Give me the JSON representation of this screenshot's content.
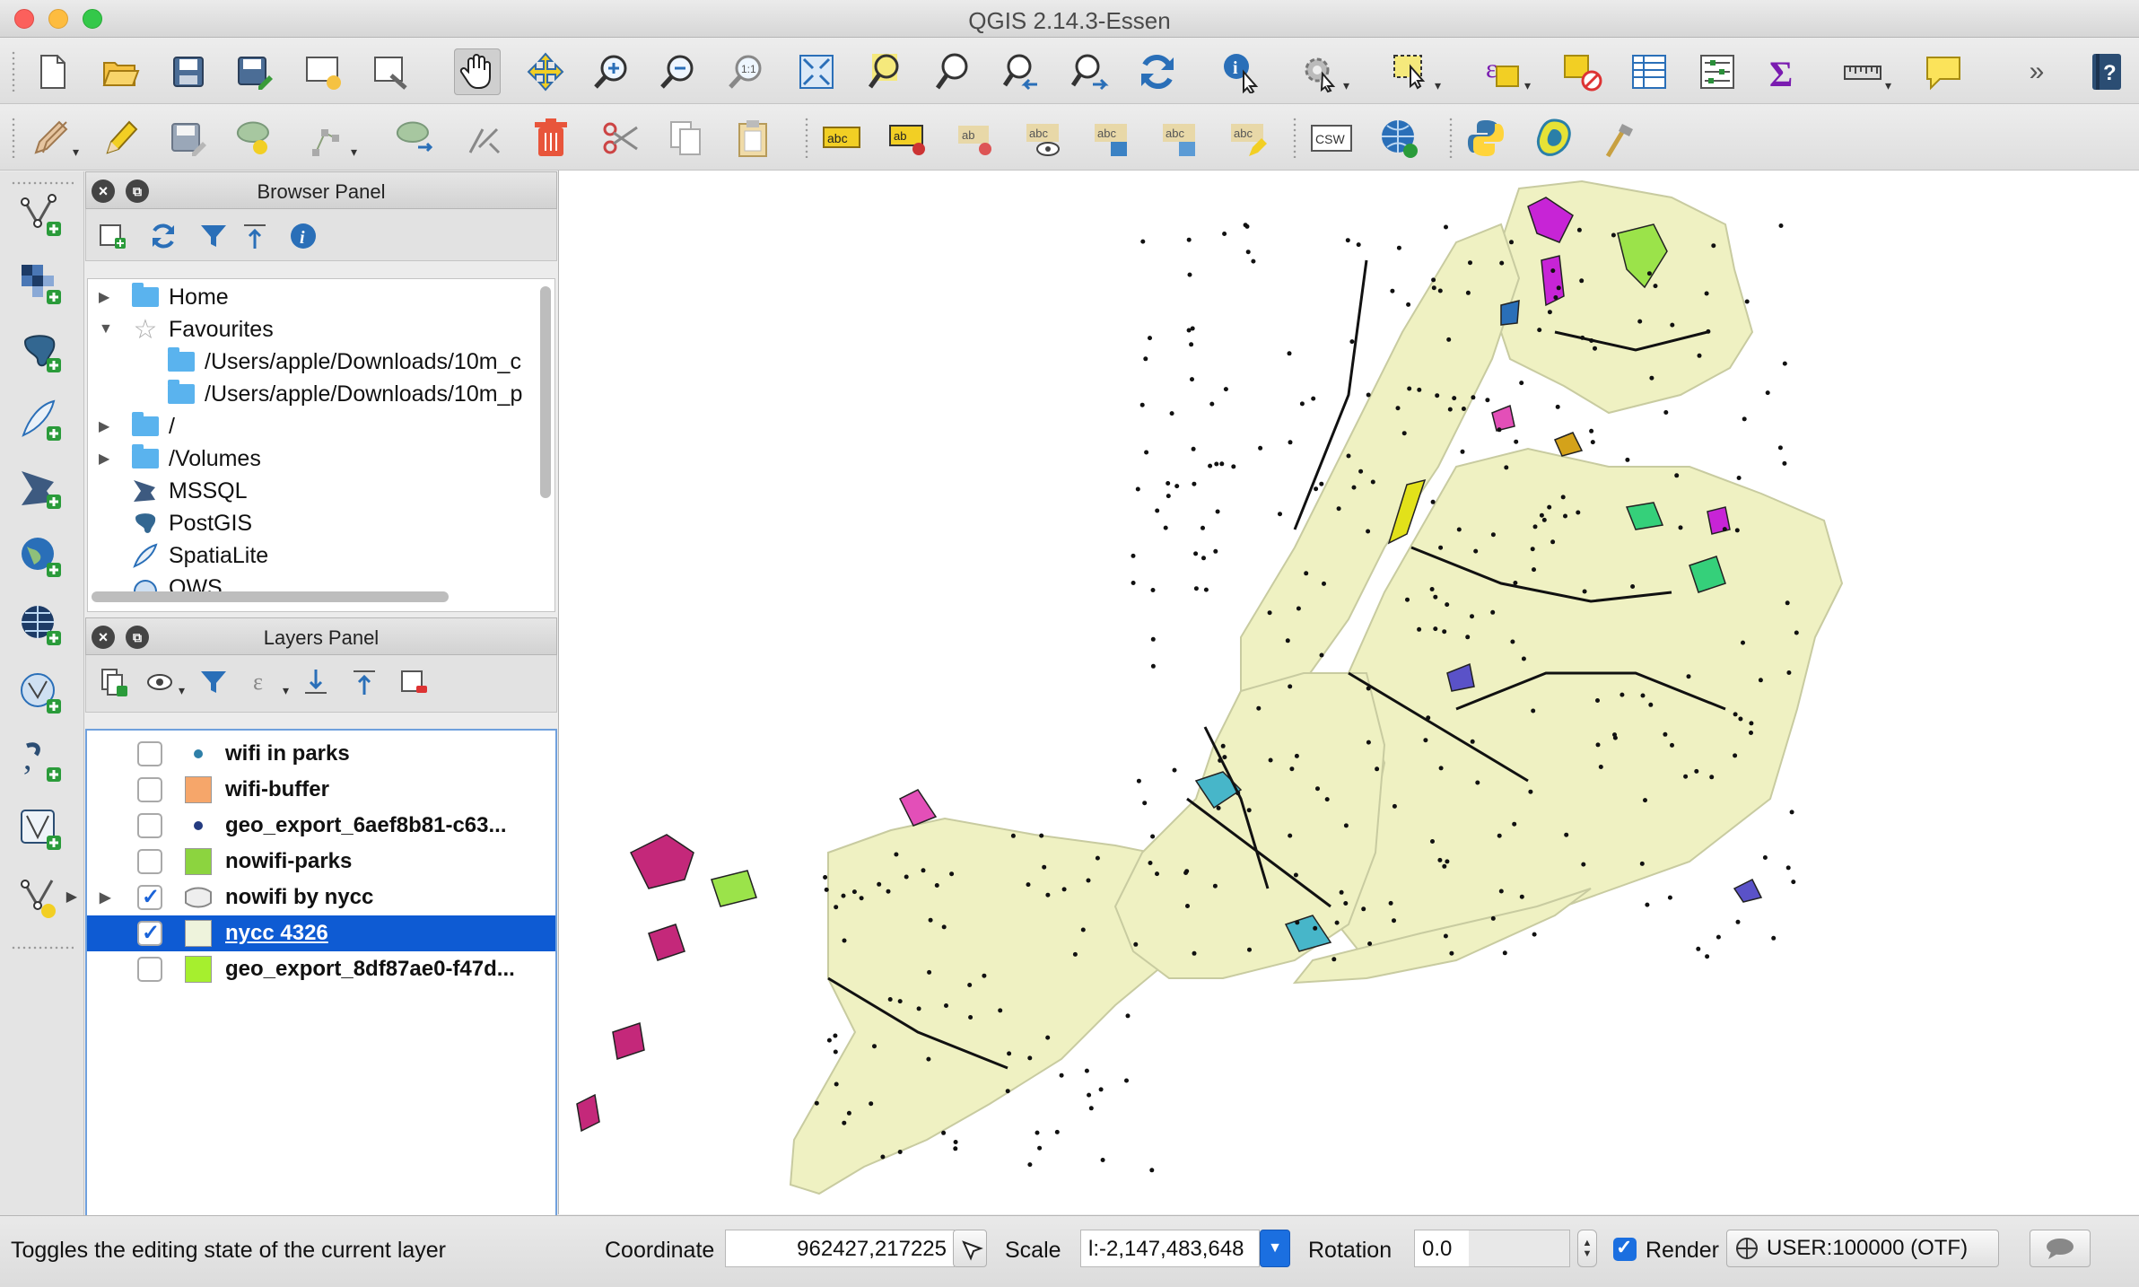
{
  "window": {
    "title": "QGIS 2.14.3-Essen"
  },
  "toolbar1": {
    "icons": [
      "new-project-icon",
      "open-project-icon",
      "save-project-icon",
      "save-as-icon",
      "new-print-composer-icon",
      "composer-manager-icon",
      "pan-icon",
      "pan-to-selection-icon",
      "zoom-in-icon",
      "zoom-out-icon",
      "zoom-native-icon",
      "zoom-full-icon",
      "zoom-to-selection-icon",
      "zoom-to-layer-icon",
      "zoom-last-icon",
      "zoom-next-icon",
      "refresh-icon",
      "identify-icon",
      "action-icon",
      "select-icon",
      "expression-select-icon",
      "deselect-icon",
      "attribute-table-icon",
      "statistics-icon",
      "sum-icon",
      "measure-icon",
      "annotation-icon",
      "overflow-icon",
      "help-icon"
    ]
  },
  "toolbar2": {
    "icons": [
      "current-edits-icon",
      "toggle-editing-icon",
      "save-edits-icon",
      "add-feature-icon",
      "node-tool-icon",
      "move-feature-icon",
      "delete-part-icon",
      "delete-selected-icon",
      "cut-features-icon",
      "copy-features-icon",
      "paste-features-icon",
      "label-tool-icon",
      "pin-labels-icon",
      "highlight-labels-icon",
      "show-hide-labels-icon",
      "move-label-icon",
      "rotate-label-icon",
      "change-label-icon",
      "csw-icon",
      "openlayers-icon",
      "python-console-icon",
      "georeferencer-icon",
      "gps-tools-icon"
    ],
    "csw_label": "CSW"
  },
  "left_toolbar": {
    "icons": [
      "add-vector-layer-icon",
      "add-raster-layer-icon",
      "add-postgis-layer-icon",
      "add-spatialite-layer-icon",
      "add-mssql-layer-icon",
      "add-wms-layer-icon",
      "add-wcs-layer-icon",
      "add-wfs-layer-icon",
      "add-delimited-text-layer-icon",
      "add-virtual-layer-icon",
      "new-shapefile-layer-icon"
    ]
  },
  "browser_panel": {
    "title": "Browser Panel",
    "tools": [
      "add-selected-icon",
      "refresh-icon",
      "filter-icon",
      "collapse-all-icon",
      "properties-icon"
    ],
    "items": [
      {
        "label": "Home",
        "icon": "folder-icon",
        "expand": "▶",
        "indent": 0
      },
      {
        "label": "Favourites",
        "icon": "star-icon",
        "expand": "▼",
        "indent": 0
      },
      {
        "label": "/Users/apple/Downloads/10m_c",
        "icon": "folder-icon",
        "expand": "",
        "indent": 1
      },
      {
        "label": "/Users/apple/Downloads/10m_p",
        "icon": "folder-icon",
        "expand": "",
        "indent": 1
      },
      {
        "label": "/",
        "icon": "folder-icon",
        "expand": "▶",
        "indent": 0
      },
      {
        "label": "/Volumes",
        "icon": "folder-icon",
        "expand": "▶",
        "indent": 0
      },
      {
        "label": "MSSQL",
        "icon": "mssql-icon",
        "expand": "",
        "indent": 0
      },
      {
        "label": "PostGIS",
        "icon": "postgis-icon",
        "expand": "",
        "indent": 0
      },
      {
        "label": "SpatiaLite",
        "icon": "spatialite-icon",
        "expand": "",
        "indent": 0
      },
      {
        "label": "OWS",
        "icon": "ows-icon",
        "expand": "",
        "indent": 0
      }
    ]
  },
  "layers_panel": {
    "title": "Layers Panel",
    "tools": [
      "add-group-icon",
      "manage-visibility-icon",
      "filter-legend-icon",
      "filter-expression-icon",
      "expand-all-icon",
      "collapse-all-icon",
      "remove-layer-icon"
    ],
    "layers": [
      {
        "label": "wifi in parks",
        "checked": false,
        "symbol": "point",
        "color": "#2e7fa8",
        "selected": false,
        "expandable": false
      },
      {
        "label": "wifi-buffer",
        "checked": false,
        "symbol": "fill",
        "color": "#f6a66a",
        "selected": false,
        "expandable": false
      },
      {
        "label": "geo_export_6aef8b81-c63...",
        "checked": false,
        "symbol": "point",
        "color": "#243b80",
        "selected": false,
        "expandable": false
      },
      {
        "label": "nowifi-parks",
        "checked": false,
        "symbol": "fill",
        "color": "#8cd43f",
        "selected": false,
        "expandable": false
      },
      {
        "label": "nowifi by nycc",
        "checked": true,
        "symbol": "categorized",
        "color": "#dcdcdc",
        "selected": false,
        "expandable": true
      },
      {
        "label": "nycc 4326",
        "checked": true,
        "symbol": "fill",
        "color": "#eef3dc",
        "selected": true,
        "expandable": false
      },
      {
        "label": "geo_export_8df87ae0-f47d...",
        "checked": false,
        "symbol": "fill",
        "color": "#a6ef2e",
        "selected": false,
        "expandable": false
      }
    ]
  },
  "map": {
    "land_color": "#eff1c2",
    "park_colors": [
      "#c724d6",
      "#9be34a",
      "#e2e11a",
      "#c4287a",
      "#47b6c9",
      "#e34fb8",
      "#5a52c8",
      "#35d07a",
      "#2a6fb8",
      "#d4a21a"
    ]
  },
  "statusbar": {
    "message": "Toggles the editing state of the current layer",
    "coordinate_label": "Coordinate",
    "coordinate_value": "962427,217225",
    "scale_label": "Scale",
    "scale_value": "l:-2,147,483,648",
    "rotation_label": "Rotation",
    "rotation_value": "0.0",
    "render_label": "Render",
    "render_checked": true,
    "crs_label": "USER:100000 (OTF)"
  }
}
